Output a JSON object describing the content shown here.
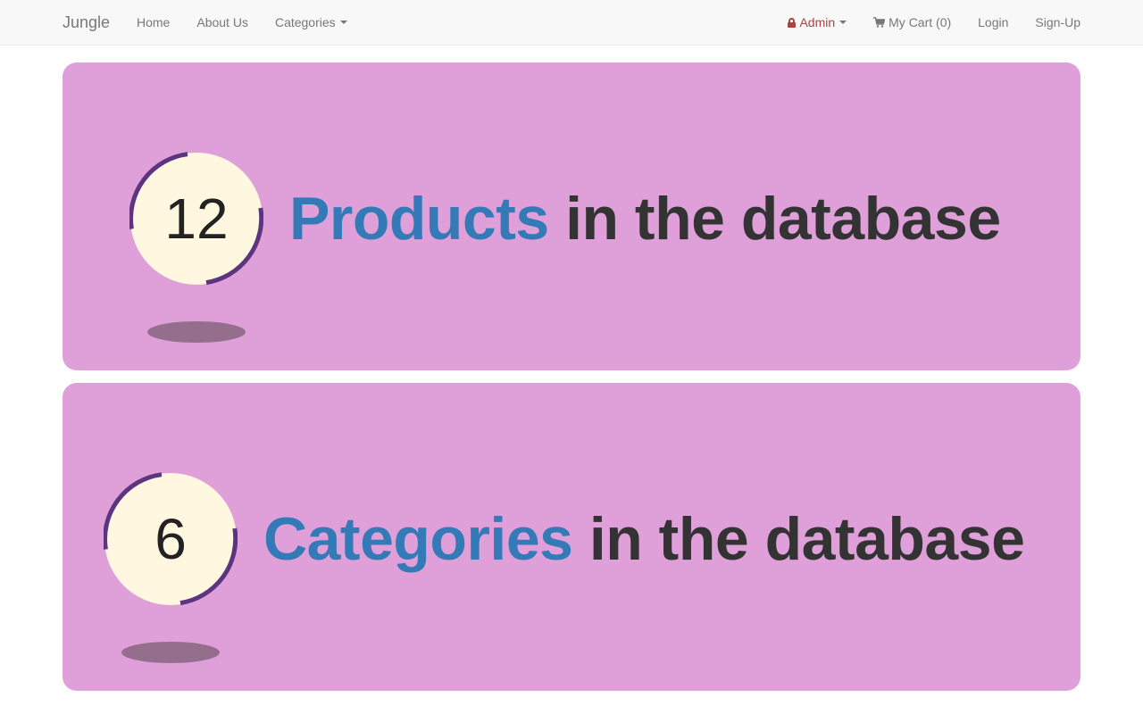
{
  "navbar": {
    "brand": "Jungle",
    "left_items": [
      {
        "label": "Home"
      },
      {
        "label": "About Us"
      },
      {
        "label": "Categories"
      }
    ],
    "admin_label": "Admin",
    "cart_label": "My Cart (0)",
    "login_label": "Login",
    "signup_label": "Sign-Up"
  },
  "stats": [
    {
      "count": "12",
      "accent": "Products",
      "rest": " in the database"
    },
    {
      "count": "6",
      "accent": "Categories",
      "rest": " in the database"
    }
  ],
  "colors": {
    "panel_bg": "#dfa0da",
    "circle_fill": "#fff7e0",
    "ring": "#5b357f",
    "accent_text": "#337ab7",
    "admin_text": "#a94442"
  },
  "icons": [
    "lock-icon",
    "cart-icon",
    "caret-down-icon"
  ]
}
